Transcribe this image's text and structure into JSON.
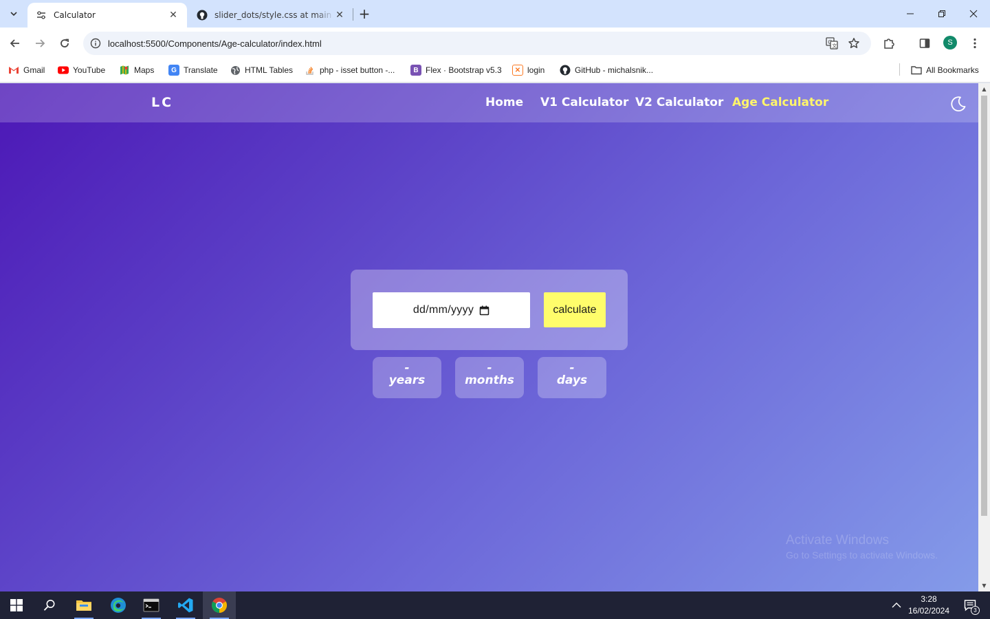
{
  "browser": {
    "tabs": [
      {
        "title": "Calculator",
        "active": true
      },
      {
        "title": "slider_dots/style.css at main · H",
        "active": false
      }
    ],
    "url": "localhost:5500/Components/Age-calculator/index.html",
    "profile_initial": "S",
    "bookmarks": [
      {
        "label": "Gmail",
        "icon": "gmail-icon"
      },
      {
        "label": "YouTube",
        "icon": "youtube-icon"
      },
      {
        "label": "Maps",
        "icon": "maps-icon"
      },
      {
        "label": "Translate",
        "icon": "translate-icon"
      },
      {
        "label": "HTML Tables",
        "icon": "globe-icon"
      },
      {
        "label": "php - isset button -...",
        "icon": "stackoverflow-icon"
      },
      {
        "label": "Flex · Bootstrap v5.3",
        "icon": "bootstrap-icon"
      },
      {
        "label": "login",
        "icon": "xampp-icon"
      },
      {
        "label": "GitHub - michalsnik...",
        "icon": "github-icon"
      }
    ],
    "all_bookmarks": "All Bookmarks"
  },
  "page": {
    "logo": "LC",
    "nav": [
      {
        "label": "Home",
        "active": false
      },
      {
        "label": "V1 Calculator",
        "active": false
      },
      {
        "label": "V2 Calculator",
        "active": false
      },
      {
        "label": "Age Calculator",
        "active": true
      }
    ],
    "theme_toggle_icon": "moon-icon",
    "date_placeholder": "dd/mm/yyyy",
    "calculate_label": "calculate",
    "results": [
      {
        "value": "-",
        "unit": "years"
      },
      {
        "value": "-",
        "unit": "months"
      },
      {
        "value": "-",
        "unit": "days"
      }
    ],
    "colors": {
      "accent": "#fffd6b",
      "gradient_start": "#4c17b6",
      "gradient_end": "#849be9"
    }
  },
  "watermark": {
    "line1": "Activate Windows",
    "line2": "Go to Settings to activate Windows."
  },
  "taskbar": {
    "time": "3:28",
    "date": "16/02/2024",
    "notification_count": "3"
  }
}
